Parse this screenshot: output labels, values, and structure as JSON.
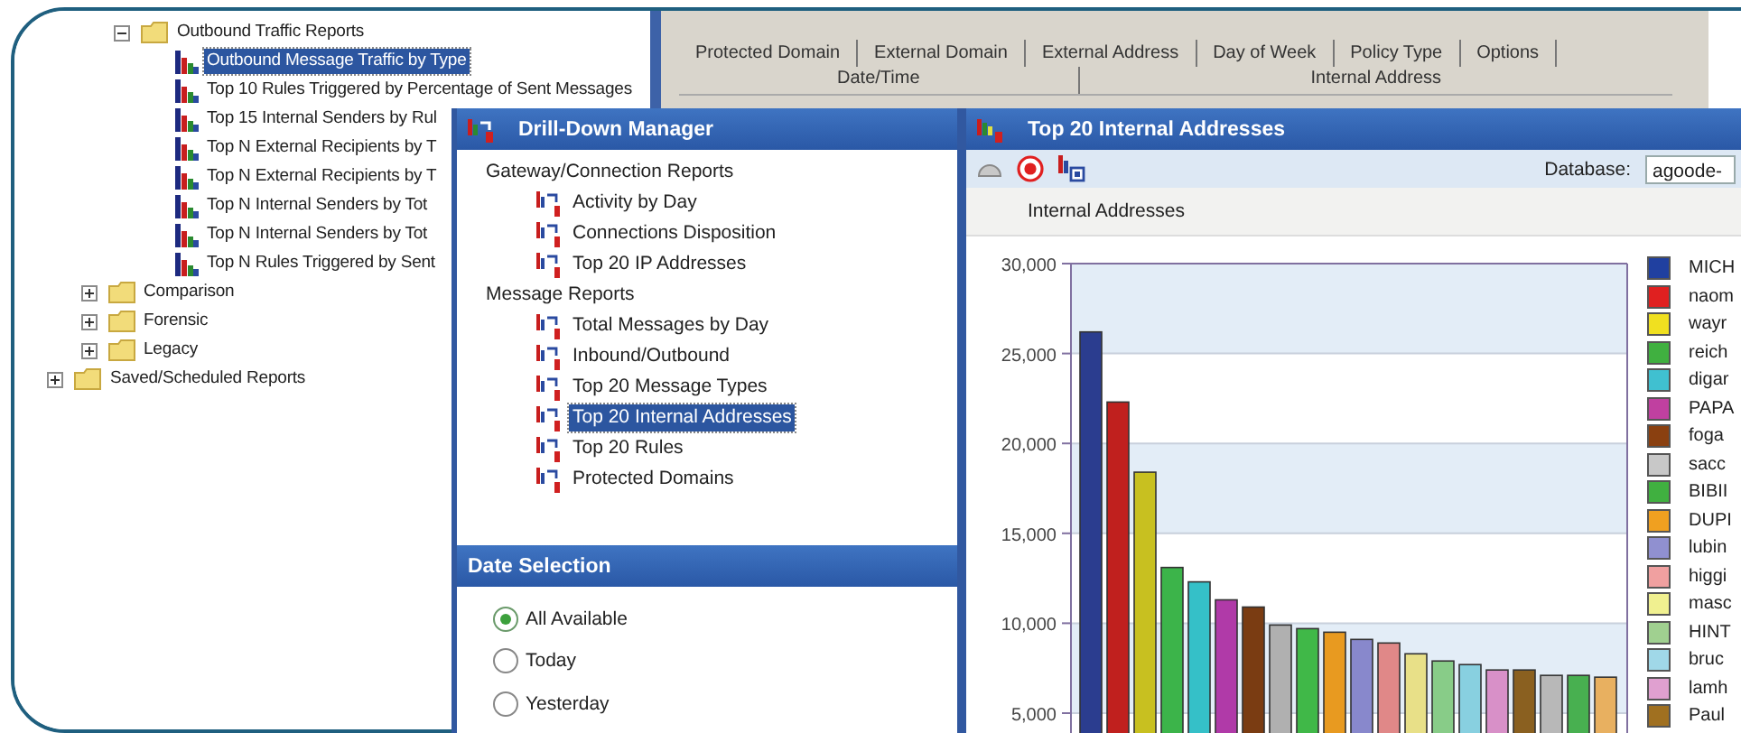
{
  "tree": [
    {
      "children": [
        {
          "children": [
            {
              "label": "Outbound Traffic Reports",
              "kind": "folder",
              "expanded": true,
              "children": [
                {
                  "label": "Outbound Message Traffic by Type",
                  "kind": "report",
                  "selected": true
                },
                {
                  "label": "Top 10 Rules Triggered by Percentage of Sent Messages",
                  "kind": "report",
                  "selected": false
                },
                {
                  "label": "Top 15 Internal Senders by Rul",
                  "kind": "report",
                  "selected": false
                },
                {
                  "label": "Top N External Recipients by T",
                  "kind": "report",
                  "selected": false
                },
                {
                  "label": "Top N External Recipients by T",
                  "kind": "report",
                  "selected": false
                },
                {
                  "label": "Top N Internal Senders by Tot",
                  "kind": "report",
                  "selected": false
                },
                {
                  "label": "Top N Internal Senders by Tot",
                  "kind": "report",
                  "selected": false
                },
                {
                  "label": "Top N Rules Triggered by Sent",
                  "kind": "report",
                  "selected": false
                }
              ]
            }
          ]
        },
        {
          "label": "Comparison",
          "kind": "folder",
          "expanded": false
        },
        {
          "label": "Forensic",
          "kind": "folder",
          "expanded": false
        },
        {
          "label": "Legacy",
          "kind": "folder",
          "expanded": false
        }
      ]
    },
    {
      "label": "Saved/Scheduled Reports",
      "kind": "folder",
      "expanded": false
    }
  ],
  "tab_rows": [
    {
      "tabs": [
        {
          "label": "Protected Domain",
          "selected": false
        },
        {
          "label": "External Domain",
          "selected": false
        },
        {
          "label": "External Address",
          "selected": false
        },
        {
          "label": "Day of Week",
          "selected": false
        },
        {
          "label": "Policy Type",
          "selected": false
        },
        {
          "label": "Options",
          "selected": false
        }
      ]
    },
    {
      "tabs": [
        {
          "label": "Date/Time",
          "selected": false
        },
        {
          "label": "Internal Address",
          "selected": false
        }
      ]
    }
  ],
  "drill_down": {
    "title": "Drill-Down Manager",
    "groups": [
      {
        "label": "Gateway/Connection Reports",
        "items": [
          {
            "label": "Activity by Day",
            "selected": false
          },
          {
            "label": "Connections Disposition",
            "selected": false
          },
          {
            "label": "Top 20 IP Addresses",
            "selected": false
          }
        ]
      },
      {
        "label": "Message Reports",
        "items": [
          {
            "label": "Total Messages by Day",
            "selected": false
          },
          {
            "label": "Inbound/Outbound",
            "selected": false
          },
          {
            "label": "Top 20 Message Types",
            "selected": false
          },
          {
            "label": "Top 20 Internal Addresses",
            "selected": true
          },
          {
            "label": "Top 20 Rules",
            "selected": false
          },
          {
            "label": "Protected Domains",
            "selected": false
          }
        ]
      }
    ]
  },
  "date_selection": {
    "title": "Date Selection",
    "options": [
      {
        "label": "All Available",
        "selected": true
      },
      {
        "label": "Today",
        "selected": false
      },
      {
        "label": "Yesterday",
        "selected": false
      }
    ]
  },
  "chart_window": {
    "title": "Top 20 Internal Addresses",
    "database_label": "Database:",
    "database_value": "agoode-",
    "section_title": "Internal Addresses",
    "chart_data": {
      "type": "bar",
      "ylim": [
        3800,
        30000
      ],
      "grid": true,
      "values": [
        26200,
        22300,
        18400,
        13100,
        12300,
        11300,
        10900,
        9900,
        9700,
        9500,
        9100,
        8900,
        8300,
        7900,
        7700,
        7400,
        7400,
        7100,
        7100,
        7000
      ],
      "yticks": [
        {
          "value": 5000,
          "label": "5,000"
        },
        {
          "value": 10000,
          "label": "10,000"
        },
        {
          "value": 15000,
          "label": "15,000"
        },
        {
          "value": 20000,
          "label": "20,000"
        },
        {
          "value": 25000,
          "label": "25,000"
        },
        {
          "value": 30000,
          "label": "30,000"
        }
      ]
    },
    "bars": [
      {
        "color": "#2b3d8f"
      },
      {
        "color": "#c0201e"
      },
      {
        "color": "#c8c020"
      },
      {
        "color": "#3cb44a"
      },
      {
        "color": "#35c0c8"
      },
      {
        "color": "#b03aa8"
      },
      {
        "color": "#7a3c12"
      },
      {
        "color": "#b0b0b0"
      },
      {
        "color": "#40b848"
      },
      {
        "color": "#e89a20"
      },
      {
        "color": "#8888cc"
      },
      {
        "color": "#e08888"
      },
      {
        "color": "#e8e088"
      },
      {
        "color": "#88cc88"
      },
      {
        "color": "#88d0e0"
      },
      {
        "color": "#d890c8"
      },
      {
        "color": "#8a6020"
      },
      {
        "color": "#b8b8b8"
      },
      {
        "color": "#48b050"
      },
      {
        "color": "#e8b060"
      }
    ],
    "legend": [
      {
        "label": "MICH",
        "color": "#2040a0"
      },
      {
        "label": "naom",
        "color": "#e02020"
      },
      {
        "label": "wayr",
        "color": "#f0e020"
      },
      {
        "label": "reich",
        "color": "#40b040"
      },
      {
        "label": "digar",
        "color": "#40c0d0"
      },
      {
        "label": "PAPA",
        "color": "#c040a0"
      },
      {
        "label": "foga",
        "color": "#8a4010"
      },
      {
        "label": "sacc",
        "color": "#c8c8c8"
      },
      {
        "label": "BIBII",
        "color": "#40b040"
      },
      {
        "label": "DUPI",
        "color": "#f0a020"
      },
      {
        "label": "lubin",
        "color": "#9090d0"
      },
      {
        "label": "higgi",
        "color": "#f0a0a0"
      },
      {
        "label": "masc",
        "color": "#f0f090"
      },
      {
        "label": "HINT",
        "color": "#a0d090"
      },
      {
        "label": "bruc",
        "color": "#a0d8e8"
      },
      {
        "label": "lamh",
        "color": "#e0a0d0"
      },
      {
        "label": "Paul",
        "color": "#a07020"
      }
    ]
  }
}
